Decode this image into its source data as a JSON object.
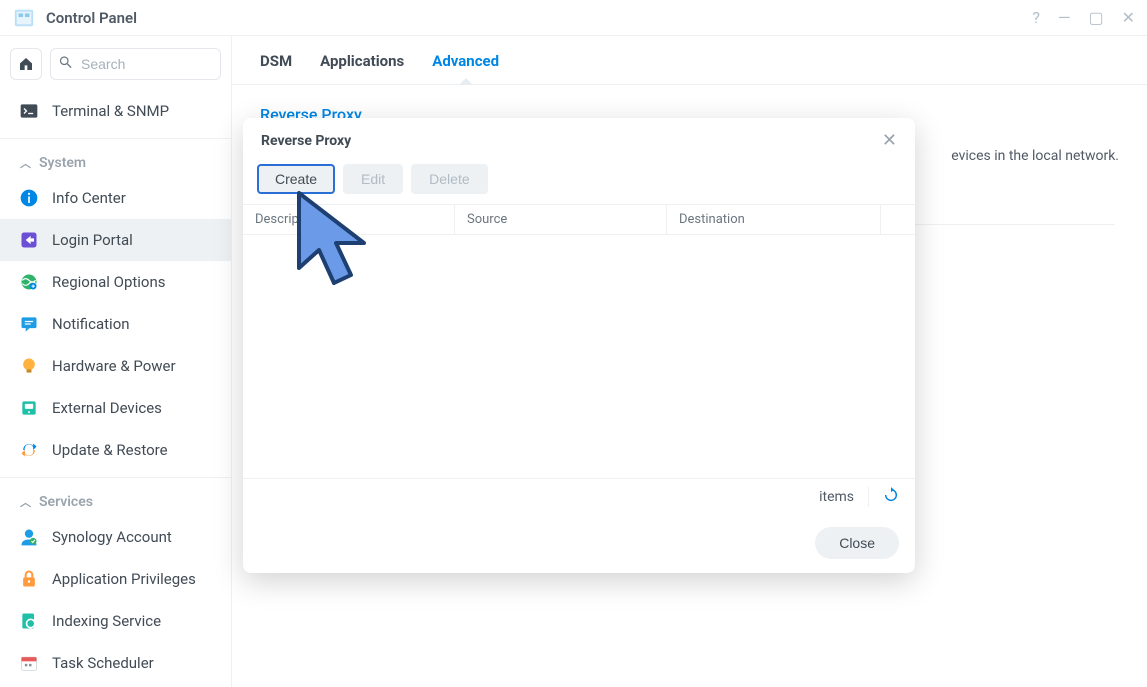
{
  "window": {
    "title": "Control Panel"
  },
  "search": {
    "placeholder": "Search"
  },
  "sidebar": {
    "terminal_label": "Terminal & SNMP",
    "section_system": "System",
    "section_services": "Services",
    "items": {
      "info_center": "Info Center",
      "login_portal": "Login Portal",
      "regional_options": "Regional Options",
      "notification": "Notification",
      "hardware_power": "Hardware & Power",
      "external_devices": "External Devices",
      "update_restore": "Update & Restore",
      "synology_account": "Synology Account",
      "application_privileges": "Application Privileges",
      "indexing_service": "Indexing Service",
      "task_scheduler": "Task Scheduler"
    }
  },
  "tabs": {
    "dsm": "DSM",
    "applications": "Applications",
    "advanced": "Advanced"
  },
  "main": {
    "section_title": "Reverse Proxy",
    "bg_text_suffix": "evices in the local network."
  },
  "modal": {
    "title": "Reverse Proxy",
    "buttons": {
      "create": "Create",
      "edit": "Edit",
      "delete": "Delete",
      "close": "Close"
    },
    "columns": {
      "description": "Description",
      "source": "Source",
      "destination": "Destination"
    },
    "status_items": "items"
  }
}
